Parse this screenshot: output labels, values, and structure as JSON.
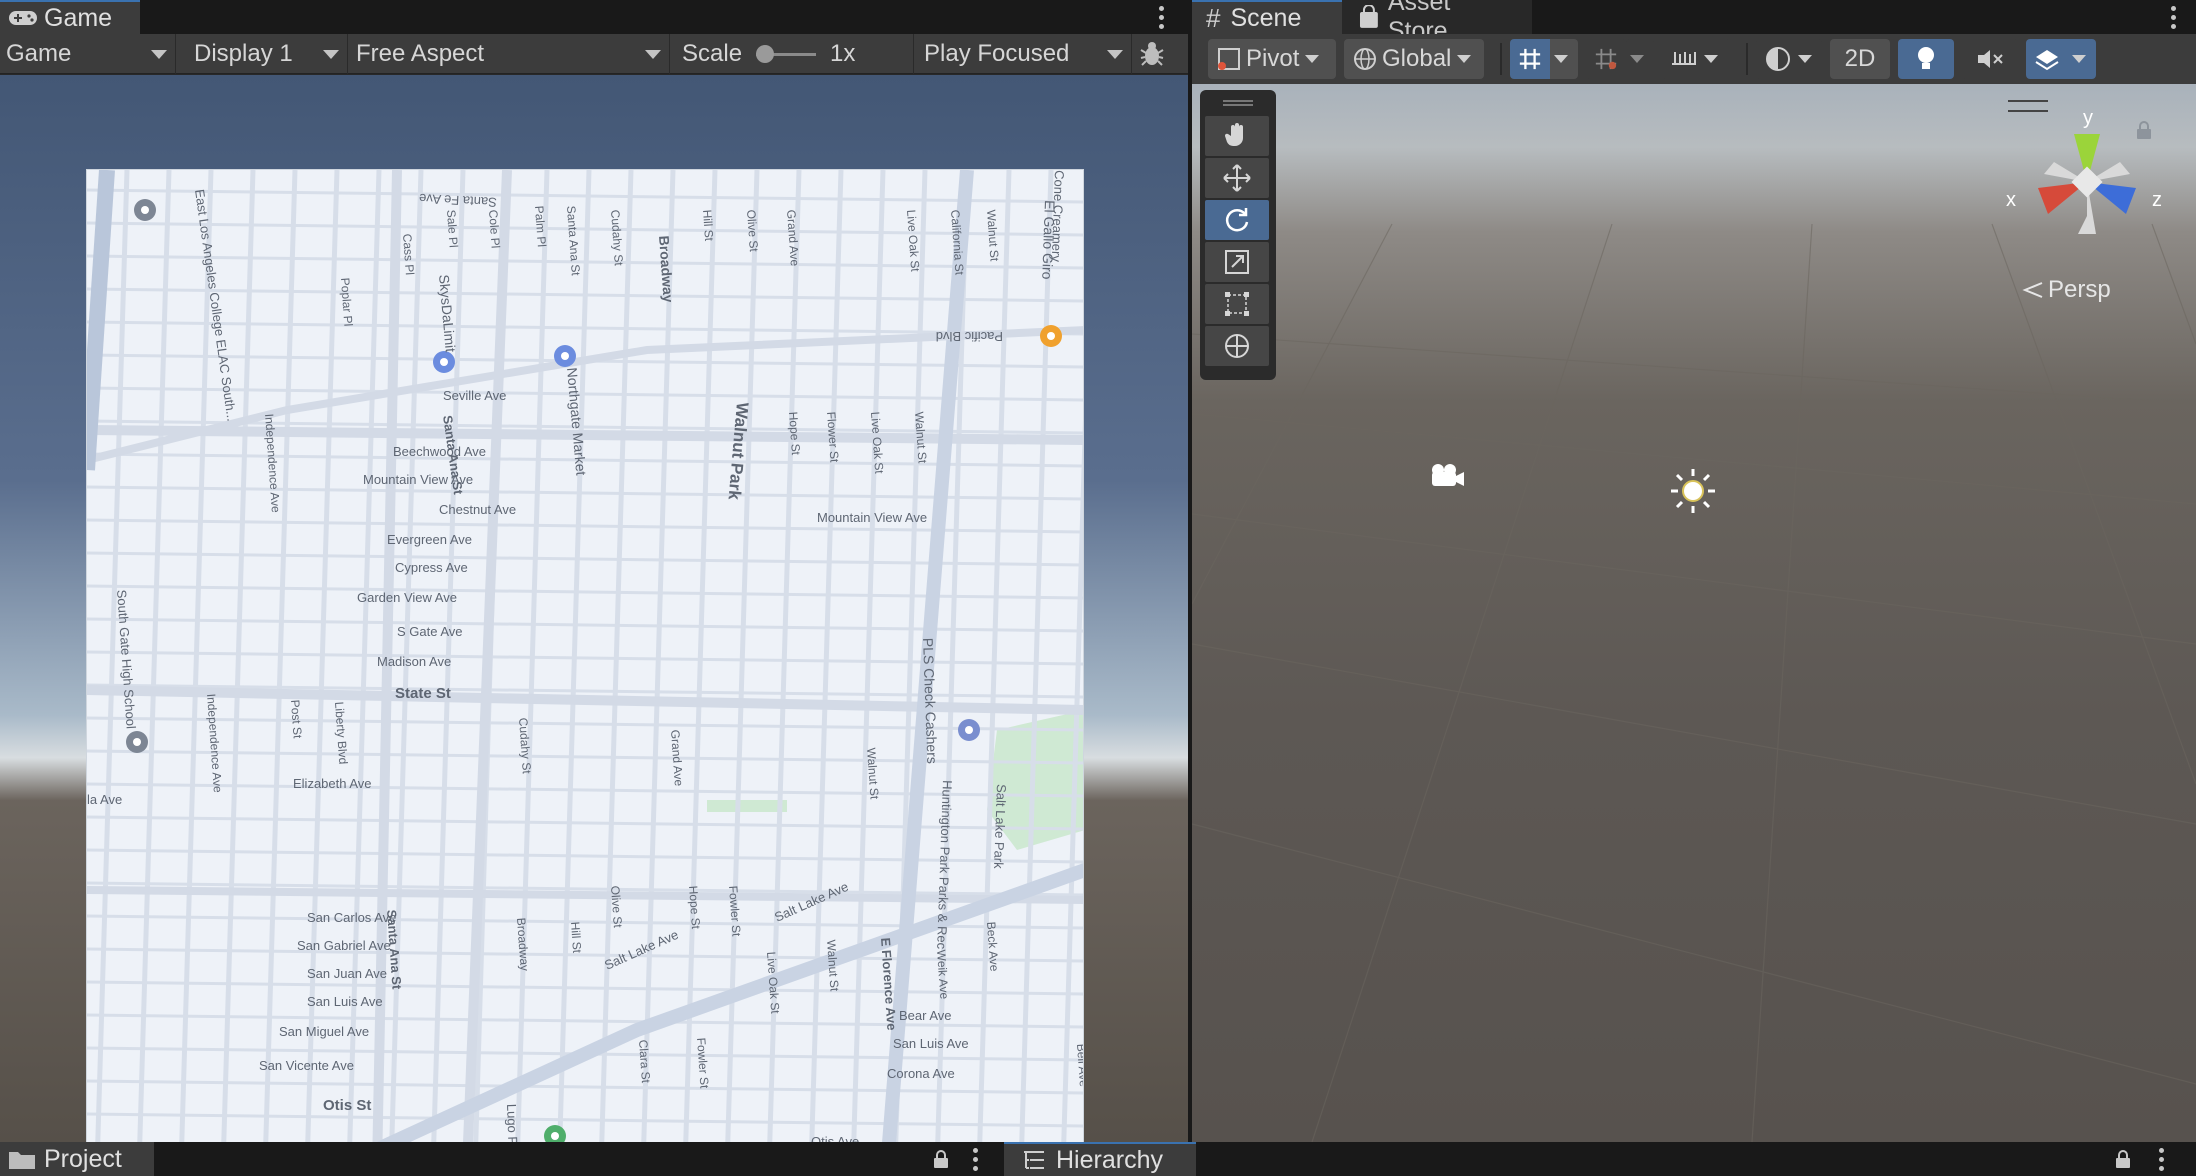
{
  "game": {
    "tab_label": "Game",
    "toolbar": {
      "mode": "Game",
      "display": "Display 1",
      "aspect": "Free Aspect",
      "scale_label": "Scale",
      "scale_value": "1x",
      "play_mode": "Play Focused"
    },
    "map": {
      "streets_h": [
        "Santa Fe Ave",
        "Seville Ave",
        "Beechwood Ave",
        "Mountain View Ave",
        "Chestnut Ave",
        "Evergreen Ave",
        "Cypress Ave",
        "Garden View Ave",
        "S Gate Ave",
        "Madison Ave",
        "State St",
        "Elizabeth Ave",
        "San Carlos Ave",
        "San Gabriel Ave",
        "San Juan Ave",
        "San Luis Ave",
        "San Miguel Ave",
        "San Vicente Ave",
        "Otis St",
        "Pacific Blvd",
        "Mountain View Ave",
        "Bear Ave",
        "San Luis Ave",
        "Corona Ave",
        "Otis Ave",
        "Salt Lake Ave",
        "Salt Lake Ave",
        "la Ave"
      ],
      "streets_v": [
        "Santa Ana St",
        "Independence Ave",
        "Poplar Pl",
        "Cass Pl",
        "Sale Pl",
        "Cole Pl",
        "Palm Pl",
        "Santa Ana St",
        "Cudahy St",
        "Broadway",
        "Hill St",
        "Olive St",
        "Grand Ave",
        "Hope St",
        "Flower St",
        "Live Oak St",
        "Walnut St",
        "California St",
        "Live Oak St",
        "Walnut St",
        "Post St",
        "Liberty Blvd",
        "Cudahy St",
        "Broadway",
        "Hill St",
        "Olive St",
        "Hope St",
        "Fowler St",
        "Live Oak St",
        "Walnut St",
        "E Florence Ave",
        "Beck Ave",
        "Weik Ave",
        "Bell Ave",
        "Clara St",
        "Fowler St",
        "Independence Ave",
        "Grand Ave",
        "Walnut St",
        "Santa Ana St"
      ],
      "places": [
        "Walnut Park",
        "East Los Angeles College ELAC South...",
        "SkysDaLimit",
        "Northgate Market",
        "El Gallo Giro",
        "South Gate High School",
        "PLS Check Cashers",
        "Huntington Park Parks & Rec",
        "Salt Lake Park",
        "Lugo Park",
        "Cone Creamery"
      ]
    }
  },
  "scene": {
    "tab_label": "Scene",
    "asset_store_label": "Asset Store",
    "toolbar": {
      "pivot": "Pivot",
      "global": "Global",
      "mode_2d": "2D"
    },
    "gizmo": {
      "y": "y",
      "x": "x",
      "z": "z",
      "projection": "Persp"
    },
    "tools": [
      "hand-tool",
      "move-tool",
      "rotate-tool",
      "scale-tool",
      "rect-tool",
      "transform-tool"
    ]
  },
  "bottom": {
    "project_label": "Project",
    "hierarchy_label": "Hierarchy"
  },
  "colors": {
    "accent": "#3a72b0",
    "active_button": "#4a6a93",
    "panel": "#3c3c3c",
    "background": "#191919"
  }
}
